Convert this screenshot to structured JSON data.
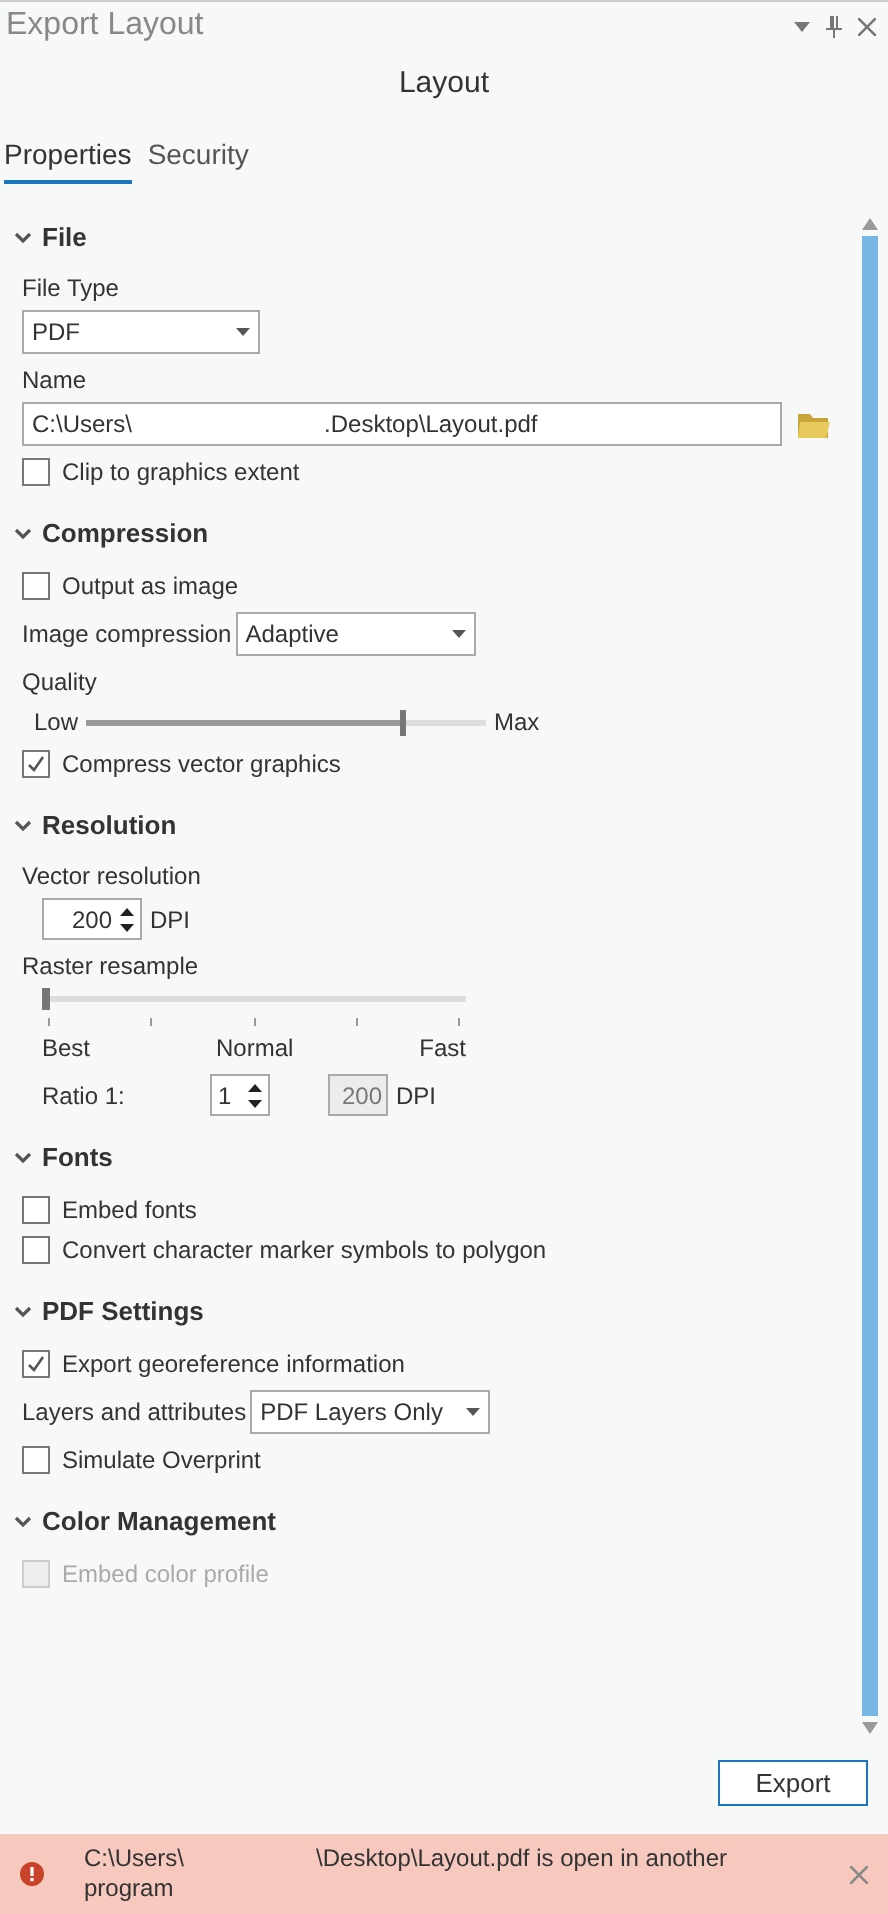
{
  "window": {
    "title": "Export Layout"
  },
  "heading": "Layout",
  "tabs": [
    {
      "label": "Properties",
      "selected": true
    },
    {
      "label": "Security",
      "selected": false
    }
  ],
  "sections": [
    {
      "title": "File",
      "expanded": true,
      "items": [
        {
          "kind": "label",
          "text": "File Type"
        },
        {
          "kind": "dropdown",
          "value": "PDF"
        },
        {
          "kind": "label",
          "text": "Name"
        },
        {
          "kind": "path",
          "value_start": "C:\\Users\\",
          "value_end": ".Desktop\\Layout.pdf"
        },
        {
          "kind": "checkbox",
          "label": "Clip to graphics extent",
          "checked": false,
          "disabled": false
        }
      ]
    },
    {
      "title": "Compression",
      "expanded": true,
      "items": [
        {
          "kind": "checkbox",
          "label": "Output as image",
          "checked": false,
          "disabled": false
        },
        {
          "kind": "select_row",
          "label": "Image compression",
          "value": "Adaptive"
        },
        {
          "kind": "label",
          "text": "Quality"
        },
        {
          "kind": "slider",
          "min_label": "Low",
          "max_label": "Max",
          "level": 0.79
        },
        {
          "kind": "checkbox",
          "label": "Compress vector graphics",
          "checked": true,
          "disabled": false
        }
      ]
    },
    {
      "title": "Resolution",
      "expanded": true,
      "items": [
        {
          "kind": "label",
          "text": "Vector resolution"
        },
        {
          "kind": "spinner",
          "value": "200",
          "unit": "DPI"
        },
        {
          "kind": "label",
          "text": "Raster resample"
        },
        {
          "kind": "resample",
          "level": 0,
          "ticks": [
            "Best",
            "Normal",
            "Fast"
          ]
        },
        {
          "kind": "ratio",
          "label": "Ratio 1:",
          "value": "1",
          "readout": "200",
          "unit": "DPI"
        }
      ]
    },
    {
      "title": "Fonts",
      "expanded": true,
      "items": [
        {
          "kind": "checkbox",
          "label": "Embed fonts",
          "checked": false,
          "disabled": false
        },
        {
          "kind": "checkbox",
          "label": "Convert character marker symbols to polygon",
          "checked": false,
          "disabled": false
        }
      ]
    },
    {
      "title": "PDF Settings",
      "expanded": true,
      "items": [
        {
          "kind": "checkbox",
          "label": "Export georeference information",
          "checked": true,
          "disabled": false
        },
        {
          "kind": "select_row",
          "label": "Layers and attributes",
          "value": "PDF Layers Only"
        },
        {
          "kind": "checkbox",
          "label": "Simulate Overprint",
          "checked": false,
          "disabled": false
        }
      ]
    },
    {
      "title": "Color Management",
      "expanded": true,
      "items": [
        {
          "kind": "checkbox",
          "label": "Embed color profile",
          "checked": false,
          "disabled": true
        }
      ]
    }
  ],
  "export_button": "Export",
  "error": {
    "message_start": "C:\\Users\\",
    "message_end": "\\Desktop\\Layout.pdf is open in another program"
  }
}
